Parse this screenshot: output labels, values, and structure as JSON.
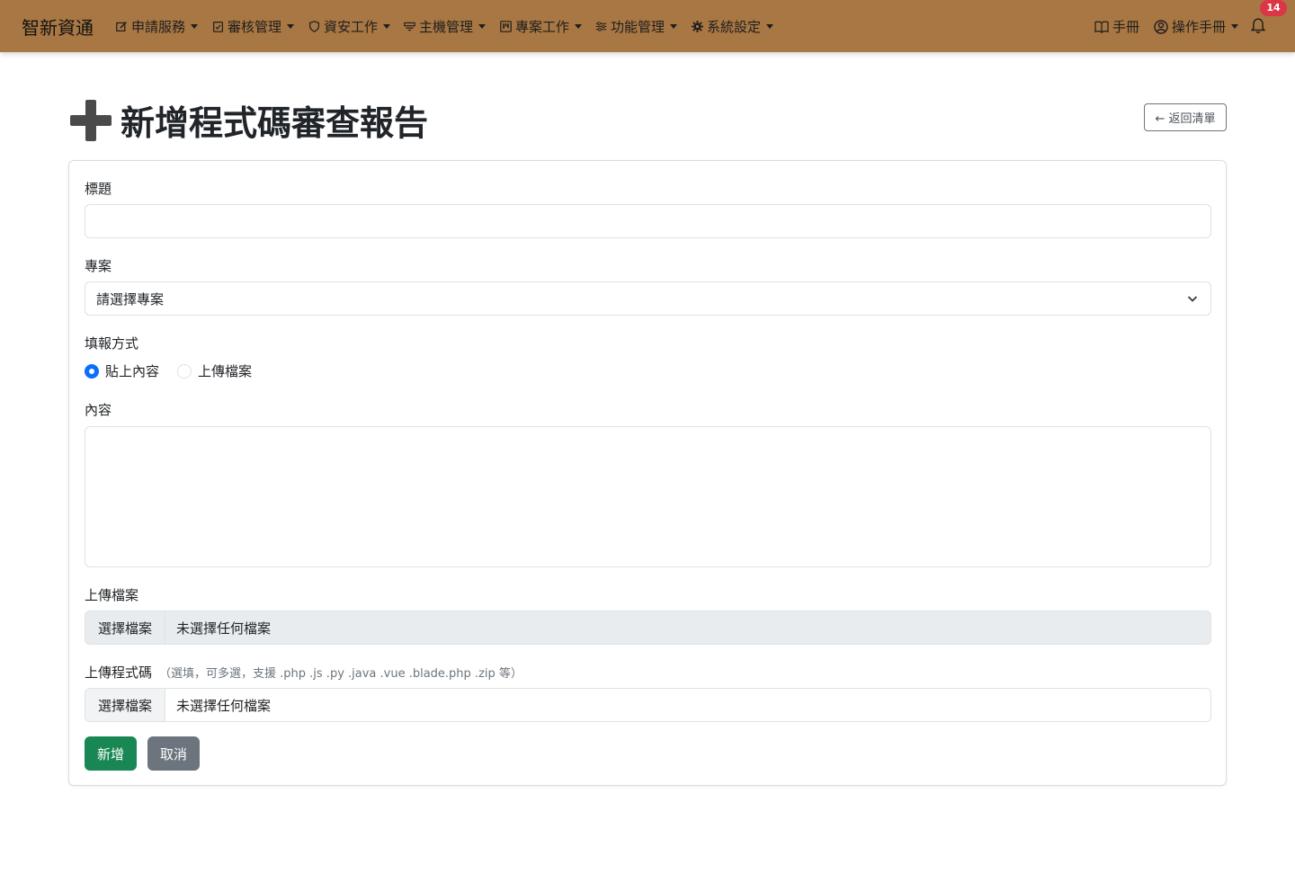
{
  "navbar": {
    "brand": "智新資通",
    "items": [
      {
        "label": "申請服務",
        "icon": "pencil-square-icon"
      },
      {
        "label": "審核管理",
        "icon": "clipboard-check-icon"
      },
      {
        "label": "資安工作",
        "icon": "shield-icon"
      },
      {
        "label": "主機管理",
        "icon": "server-icon"
      },
      {
        "label": "專案工作",
        "icon": "kanban-icon"
      },
      {
        "label": "功能管理",
        "icon": "sliders-icon"
      },
      {
        "label": "系統設定",
        "icon": "gear-icon"
      }
    ],
    "manual": "手冊",
    "user_menu": "操作手冊",
    "notification_count": "14",
    "color": "#a87743"
  },
  "header": {
    "title": "新增程式碼審查報告",
    "back_label": "← 返回清單"
  },
  "form": {
    "title_label": "標題",
    "title_value": "",
    "project_label": "專案",
    "project_selected": "請選擇專案",
    "method_label": "填報方式",
    "method_options": [
      "貼上內容",
      "上傳檔案"
    ],
    "method_selected": "貼上內容",
    "content_label": "內容",
    "content_value": "",
    "upload_label": "上傳檔案",
    "upload_button": "選擇檔案",
    "upload_status": "未選擇任何檔案",
    "code_label": "上傳程式碼",
    "code_hint": "（選填，可多選，支援 .php .js .py .java .vue .blade.php .zip 等）",
    "code_button": "選擇檔案",
    "code_status": "未選擇任何檔案",
    "submit_label": "新增",
    "cancel_label": "取消"
  },
  "colors": {
    "primary": "#0d6efd",
    "success": "#198754",
    "secondary": "#6c757d",
    "danger": "#dc3545"
  }
}
